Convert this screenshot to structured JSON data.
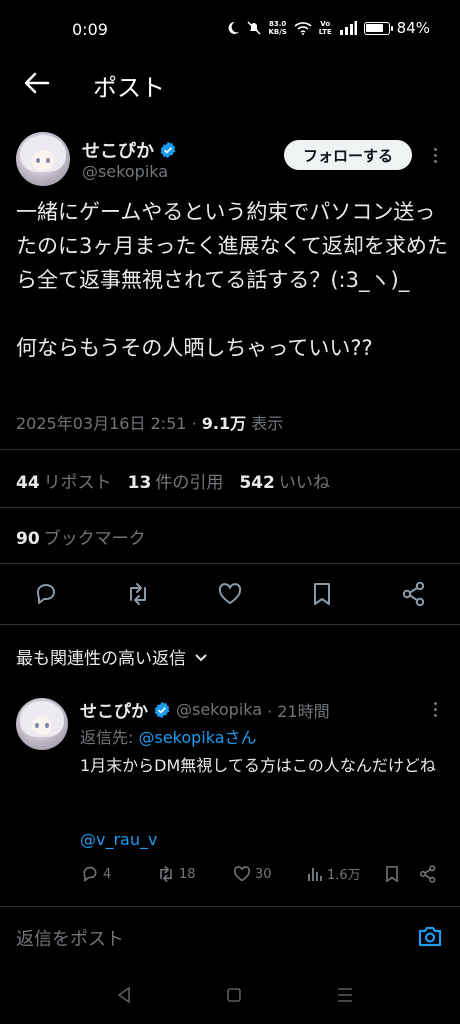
{
  "status_bar": {
    "time": "0:09",
    "speed_value": "83.0",
    "speed_unit": "KB/S",
    "volte": "Vo\nLTE",
    "battery_pct": "84%",
    "battery_level": 0.84
  },
  "header": {
    "title": "ポスト"
  },
  "post": {
    "author_name": "せこぴか",
    "author_handle": "@sekopika",
    "follow_label": "フォローする",
    "text": "一緒にゲームやるという約束でパソコン送ったのに3ヶ月まったく進展なくて返却を求めたら全て返事無視されてる話する？(:3_ヽ)_\n\n何ならもうその人晒しちゃっていい??",
    "timestamp": "2025年03月16日 2:51",
    "sep": "·",
    "views_count": "9.1万",
    "views_label": "表示"
  },
  "stats": {
    "reposts_count": "44",
    "reposts_label": "リポスト",
    "quotes_count": "13",
    "quotes_label": "件の引用",
    "likes_count": "542",
    "likes_label": "いいね",
    "bookmarks_count": "90",
    "bookmarks_label": "ブックマーク"
  },
  "actions": [
    "reply-icon",
    "retweet-icon",
    "like-icon",
    "bookmark-icon",
    "share-icon"
  ],
  "sort": {
    "label": "最も関連性の高い返信"
  },
  "reply": {
    "author_name": "せこぴか",
    "author_handle": "@sekopika",
    "time": "· 21時間",
    "reply_to_prefix": "返信先: ",
    "reply_to_handle": "@sekopikaさん",
    "text": "1月末からDM無視してる方はこの人なんだけどね",
    "mention": "@v_rau_v",
    "replies": "4",
    "retweets": "18",
    "likes": "30",
    "views": "1.6万"
  },
  "compose": {
    "placeholder": "返信をポスト"
  },
  "colors": {
    "accent": "#1d9bf0",
    "muted": "#71767b",
    "text": "#e7e9ea",
    "divider": "#2f3336"
  }
}
